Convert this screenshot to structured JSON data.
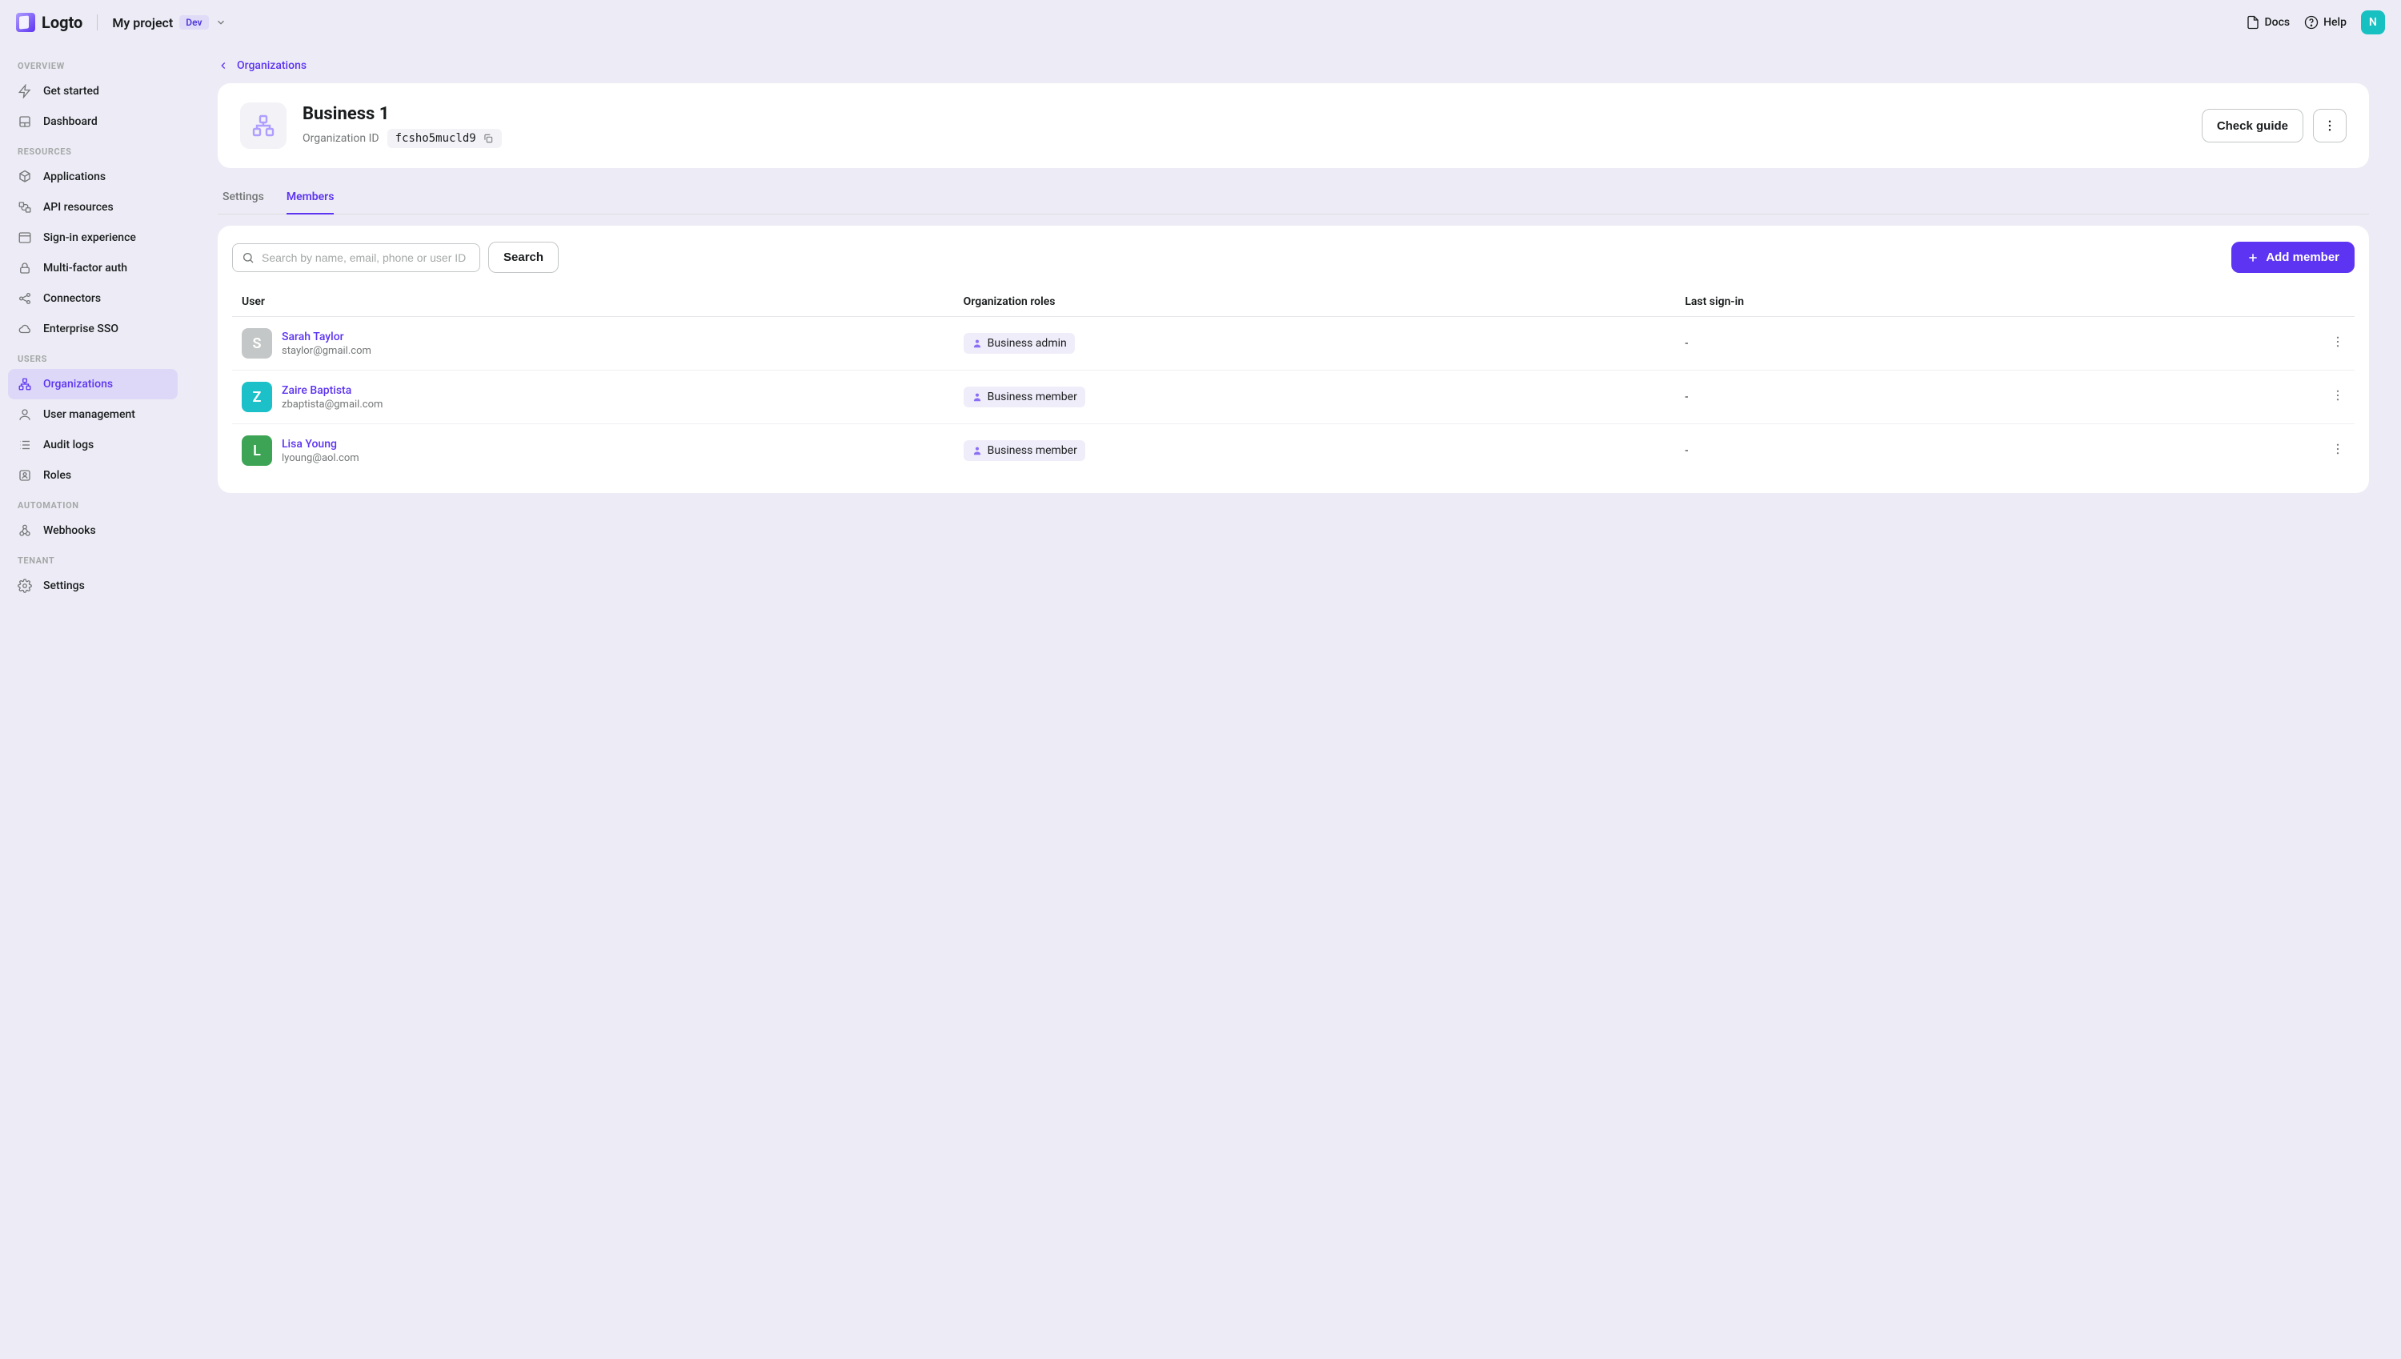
{
  "brand": {
    "name": "Logto"
  },
  "topbar": {
    "project_name": "My project",
    "env_badge": "Dev",
    "docs_label": "Docs",
    "help_label": "Help",
    "avatar_initial": "N"
  },
  "sidebar": {
    "sections": [
      {
        "label": "OVERVIEW",
        "items": [
          {
            "label": "Get started",
            "icon": "bolt"
          },
          {
            "label": "Dashboard",
            "icon": "dashboard"
          }
        ]
      },
      {
        "label": "RESOURCES",
        "items": [
          {
            "label": "Applications",
            "icon": "cube"
          },
          {
            "label": "API resources",
            "icon": "api"
          },
          {
            "label": "Sign-in experience",
            "icon": "window"
          },
          {
            "label": "Multi-factor auth",
            "icon": "lock"
          },
          {
            "label": "Connectors",
            "icon": "share"
          },
          {
            "label": "Enterprise SSO",
            "icon": "cloud"
          }
        ]
      },
      {
        "label": "USERS",
        "items": [
          {
            "label": "Organizations",
            "icon": "org",
            "active": true
          },
          {
            "label": "User management",
            "icon": "user"
          },
          {
            "label": "Audit logs",
            "icon": "list"
          },
          {
            "label": "Roles",
            "icon": "badge"
          }
        ]
      },
      {
        "label": "AUTOMATION",
        "items": [
          {
            "label": "Webhooks",
            "icon": "hook"
          }
        ]
      },
      {
        "label": "TENANT",
        "items": [
          {
            "label": "Settings",
            "icon": "gear"
          }
        ]
      }
    ]
  },
  "breadcrumb": {
    "label": "Organizations"
  },
  "org": {
    "title": "Business 1",
    "id_label": "Organization ID",
    "id_value": "fcsho5mucld9",
    "check_guide_label": "Check guide"
  },
  "tabs": {
    "settings": "Settings",
    "members": "Members"
  },
  "members": {
    "search_placeholder": "Search by name, email, phone or user ID",
    "search_button": "Search",
    "add_button": "Add member",
    "columns": {
      "user": "User",
      "roles": "Organization roles",
      "signin": "Last sign-in"
    },
    "rows": [
      {
        "initial": "S",
        "avatar_bg": "#c4c7c7",
        "name": "Sarah Taylor",
        "email": "staylor@gmail.com",
        "role": "Business admin",
        "signin": "-"
      },
      {
        "initial": "Z",
        "avatar_bg": "#1bc0c9",
        "name": "Zaire Baptista",
        "email": "zbaptista@gmail.com",
        "role": "Business member",
        "signin": "-"
      },
      {
        "initial": "L",
        "avatar_bg": "#3da455",
        "name": "Lisa Young",
        "email": "lyoung@aol.com",
        "role": "Business member",
        "signin": "-"
      }
    ]
  }
}
